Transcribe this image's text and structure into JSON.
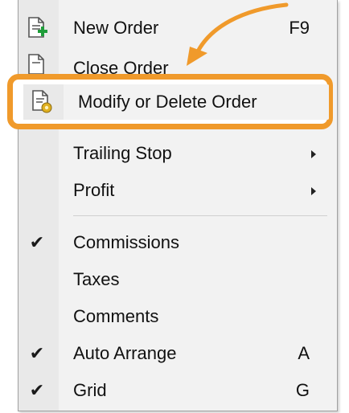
{
  "menu": {
    "items": [
      {
        "label": "New Order",
        "shortcut": "F9",
        "icon": "new-order-icon"
      },
      {
        "label": "Close Order",
        "icon": "close-order-icon"
      },
      {
        "label": "Modify or Delete Order",
        "icon": "modify-order-icon"
      },
      {
        "label": "Trailing Stop",
        "submenu": true
      },
      {
        "label": "Profit",
        "submenu": true
      },
      {
        "label": "Commissions",
        "checked": true
      },
      {
        "label": "Taxes",
        "checked": false
      },
      {
        "label": "Comments",
        "checked": false
      },
      {
        "label": "Auto Arrange",
        "checked": true,
        "shortcut": "A"
      },
      {
        "label": "Grid",
        "checked": true,
        "shortcut": "G"
      }
    ]
  },
  "annotation": {
    "color": "#f09a2b"
  }
}
